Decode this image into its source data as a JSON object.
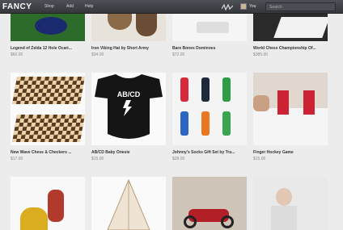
{
  "header": {
    "logo": "FANCY",
    "nav": [
      "Shop",
      "Add",
      "Help"
    ],
    "user_label": "You",
    "search_placeholder": "Search"
  },
  "products": [
    {
      "title": "Legend of Zelda 12 Hole Ocari...",
      "price": "$60.00"
    },
    {
      "title": "Iron Viking Hat by Short Army",
      "price": "$34.00"
    },
    {
      "title": "Bare Bones Dominoes",
      "price": "$72.00"
    },
    {
      "title": "World Chess Championship Of...",
      "price": "$385.00"
    },
    {
      "title": "New Wave Chess & Checkers ...",
      "price": "$17.00"
    },
    {
      "title": "AB/CD Baby Onesie",
      "price": "$15.00"
    },
    {
      "title": "Johnny's Socks Gift Set by Tru...",
      "price": "$28.00"
    },
    {
      "title": "Finger Hockey Game",
      "price": "$15.00"
    },
    {
      "title": "",
      "price": ""
    },
    {
      "title": "",
      "price": ""
    },
    {
      "title": "",
      "price": ""
    },
    {
      "title": "",
      "price": ""
    }
  ],
  "onesie_text": "AB/CD"
}
